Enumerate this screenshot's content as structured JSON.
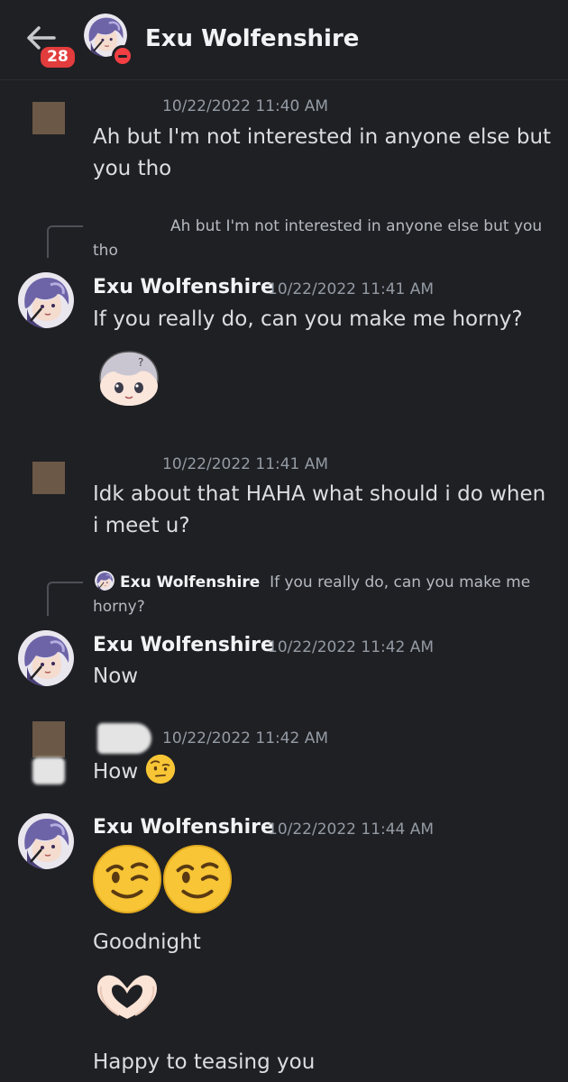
{
  "header": {
    "back_icon": "arrow-left-icon",
    "unread_badge": "28",
    "title": "Exu Wolfenshire",
    "status": "do-not-disturb"
  },
  "messages": [
    {
      "timestamp": "10/22/2022 11:40 AM",
      "text": "Ah but I'm not interested in anyone else but you tho"
    },
    {
      "reply_preview": "Ah but I'm not interested in anyone else but you tho",
      "author": "Exu Wolfenshire",
      "timestamp": "10/22/2022 11:41 AM",
      "text": "If you really do, can you make me horny?",
      "sticker": "chibi-avatar-sticker"
    },
    {
      "timestamp": "10/22/2022 11:41 AM",
      "text": "Idk about that HAHA what should i do when i meet u?"
    },
    {
      "reply_author": "Exu Wolfenshire",
      "reply_preview": "If you really do, can you make me horny?",
      "author": "Exu Wolfenshire",
      "timestamp": "10/22/2022 11:42 AM",
      "text": "Now"
    },
    {
      "timestamp": "10/22/2022 11:42 AM",
      "text": "How",
      "emoji": "face-with-raised-eyebrow-emoji"
    },
    {
      "author": "Exu Wolfenshire",
      "timestamp": "10/22/2022 11:44 AM",
      "emojis": [
        "winking-face-emoji",
        "winking-face-emoji"
      ],
      "text_2": "Goodnight",
      "emoji_2": "heart-hands-emoji",
      "text_3": "Happy to teasing you"
    }
  ],
  "colors": {
    "background": "#1f2024",
    "text": "#dbdee1",
    "timestamp": "#949ba4",
    "badge": "#e23c3c",
    "dnd": "#f23f43"
  }
}
